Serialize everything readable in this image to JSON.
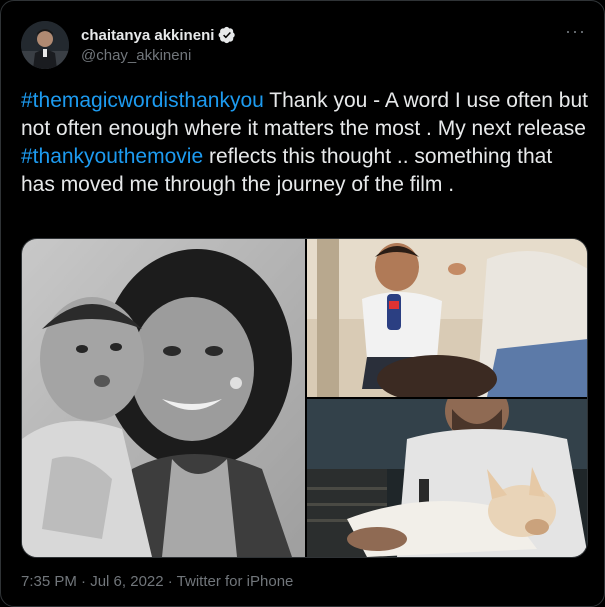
{
  "author": {
    "display_name": "chaitanya akkineni",
    "handle": "@chay_akkineni",
    "verified_icon": "verified-badge-icon",
    "avatar_icon": "avatar"
  },
  "menu": {
    "more_label": "···"
  },
  "tweet": {
    "segments": [
      {
        "type": "hashtag",
        "text": "#themagicwordisthankyou"
      },
      {
        "type": "text",
        "text": " Thank you - A word I use often but not often enough where it matters the most . My next release "
      },
      {
        "type": "hashtag",
        "text": "#thankyouthemovie"
      },
      {
        "type": "text",
        "text": " reflects this thought .. something that has moved me through the journey of the film ."
      }
    ]
  },
  "meta": {
    "time": "7:35 PM",
    "sep1": " · ",
    "date": "Jul 6, 2022",
    "sep2": " · ",
    "source": "Twitter for iPhone"
  },
  "colors": {
    "background": "#000000",
    "text": "#e7e9ea",
    "muted": "#71767b",
    "link": "#1d9bf0",
    "border": "#2f3336"
  }
}
